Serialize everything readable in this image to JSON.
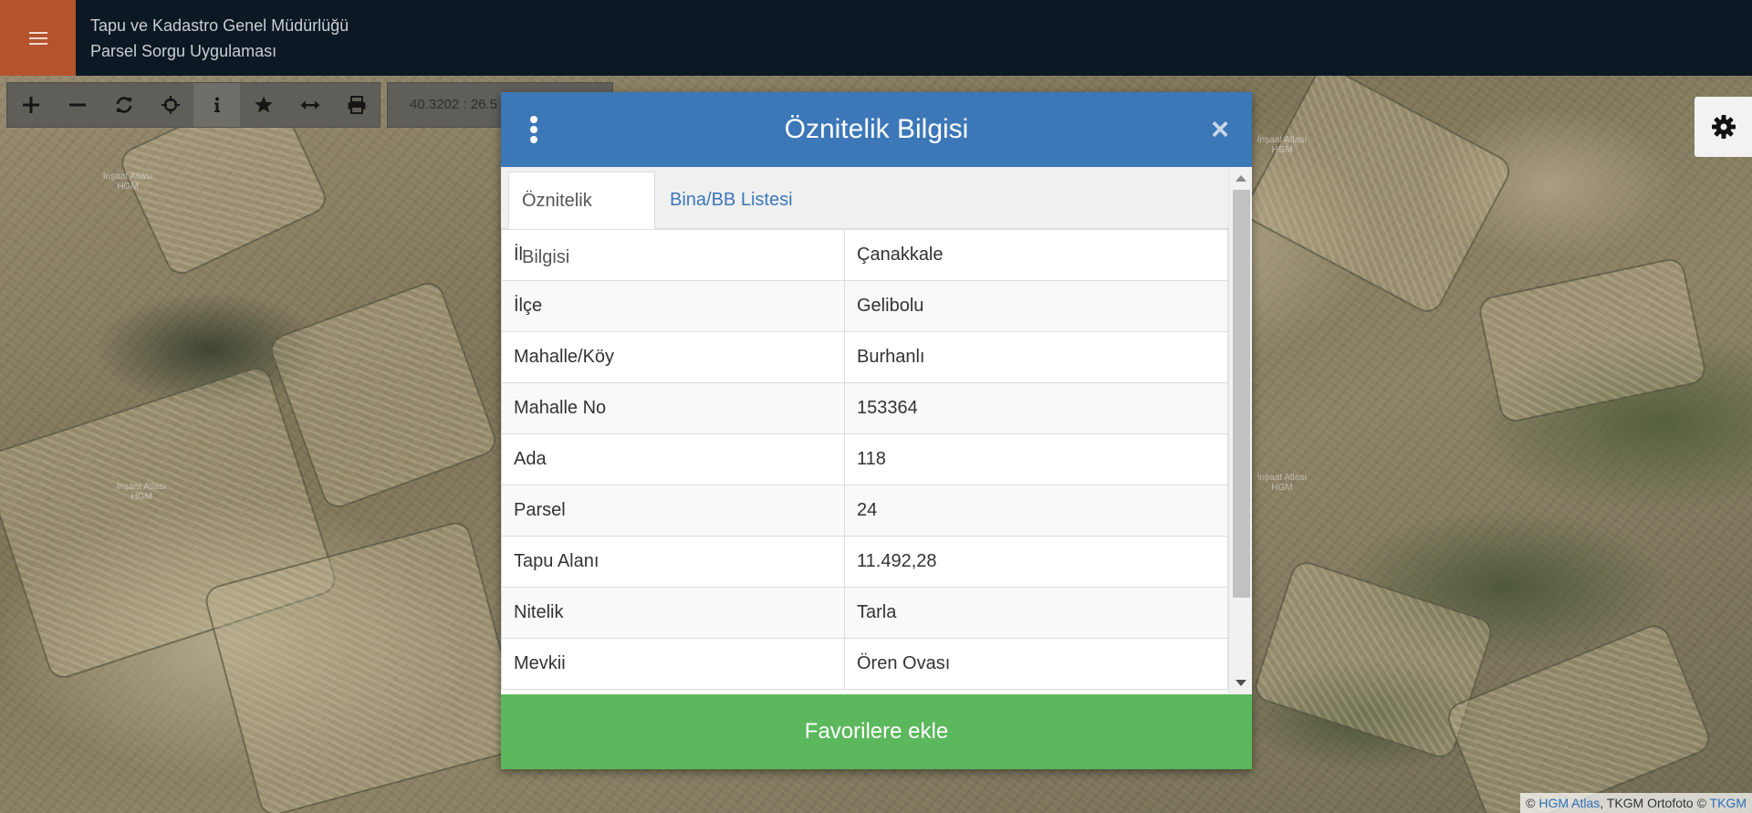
{
  "header": {
    "title_line1": "Tapu ve Kadastro Genel Müdürlüğü",
    "title_line2": "Parsel Sorgu Uygulaması"
  },
  "toolbar": {
    "tools": [
      {
        "icon": "zoom-in-icon",
        "active": false
      },
      {
        "icon": "zoom-out-icon",
        "active": false
      },
      {
        "icon": "refresh-icon",
        "active": false
      },
      {
        "icon": "locate-icon",
        "active": false
      },
      {
        "icon": "info-icon",
        "active": true
      },
      {
        "icon": "star-icon",
        "active": false
      },
      {
        "icon": "measure-icon",
        "active": false
      },
      {
        "icon": "print-icon",
        "active": false
      }
    ],
    "coordinates": "40.3202 : 26.5"
  },
  "map_labels": [
    {
      "text": "İnşaat Atlası HGM"
    },
    {
      "text": "İnşaat Atlası HGM"
    },
    {
      "text": "İnşaat Atlası HGM"
    },
    {
      "text": "İnşaat Atlası HGM"
    }
  ],
  "modal": {
    "title": "Öznitelik Bilgisi",
    "close_symbol": "×",
    "tabs": [
      {
        "label": "Öznitelik Bilgisi",
        "active": true
      },
      {
        "label": "Bina/BB Listesi",
        "active": false
      }
    ],
    "rows": [
      {
        "key": "İl",
        "value": "Çanakkale"
      },
      {
        "key": "İlçe",
        "value": "Gelibolu"
      },
      {
        "key": "Mahalle/Köy",
        "value": "Burhanlı"
      },
      {
        "key": "Mahalle No",
        "value": "153364"
      },
      {
        "key": "Ada",
        "value": "118"
      },
      {
        "key": "Parsel",
        "value": "24"
      },
      {
        "key": "Tapu Alanı",
        "value": "11.492,28"
      },
      {
        "key": "Nitelik",
        "value": "Tarla"
      },
      {
        "key": "Mevkii",
        "value": "Ören Ovası"
      }
    ],
    "favorite_button": "Favorilere ekle"
  },
  "attribution": {
    "copyright1": "©",
    "link1": "HGM Atlas",
    "middle": ", TKGM Ortofoto ©",
    "link2": "TKGM"
  },
  "colors": {
    "header_bg": "#0c1824",
    "menu_accent": "#b5532d",
    "modal_header": "#3c77b8",
    "favorite_green": "#5cb85c"
  }
}
